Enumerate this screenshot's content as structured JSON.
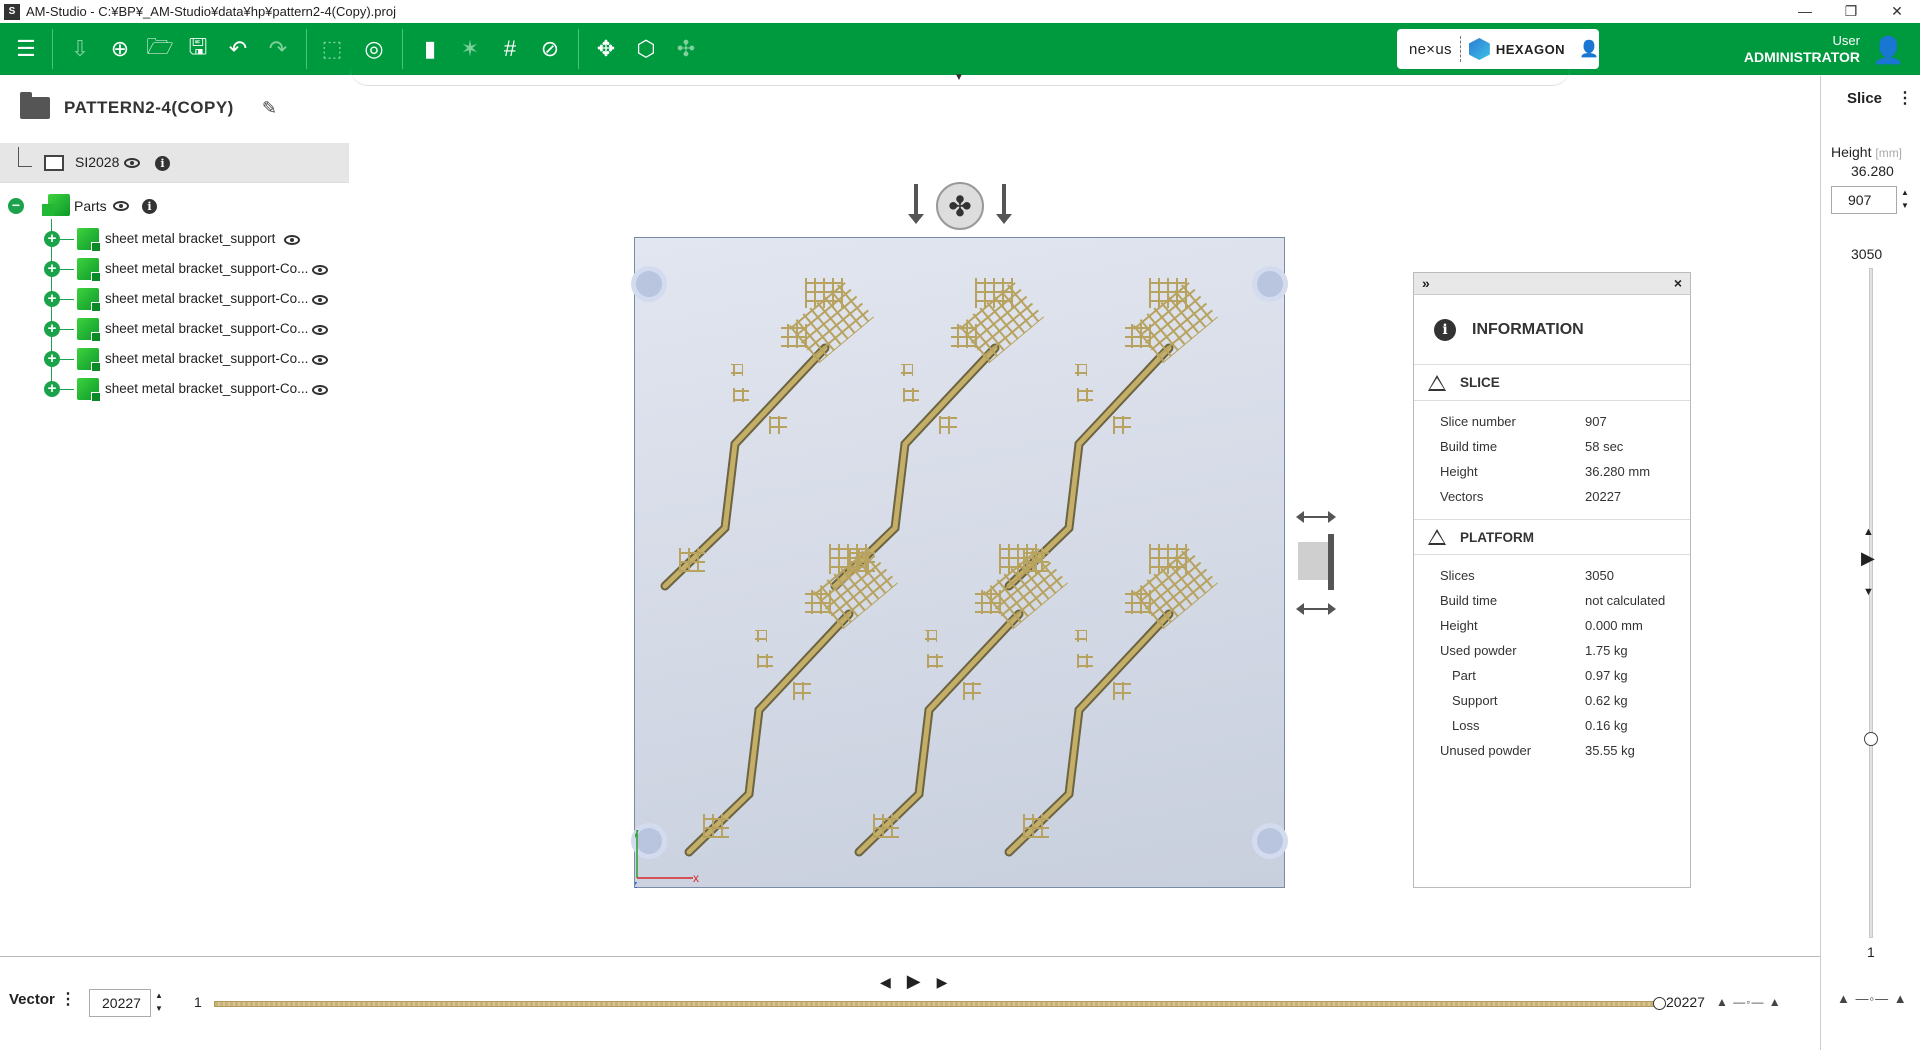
{
  "window": {
    "title": "AM-Studio - C:¥BP¥_AM-Studio¥data¥hp¥pattern2-4(Copy).proj",
    "app_icon_text": "S",
    "controls": {
      "minimize": "—",
      "maximize": "❐",
      "close": "✕"
    }
  },
  "toolbar": {
    "accent_color": "#009a3e",
    "icons": [
      "menu-icon",
      "import-icon",
      "add-icon",
      "open-folder-icon",
      "save-icon",
      "undo-icon",
      "redo-icon",
      "box-view-icon",
      "snapshot-icon",
      "cube-icon",
      "support-icon",
      "hatch-icon",
      "slice-icon",
      "move-icon",
      "orient-icon",
      "disabled-tool-icon"
    ],
    "brand": {
      "nexus": "ne×us",
      "hexagon": "HEXAGON"
    },
    "user": {
      "label": "User",
      "name": "ADMINISTRATOR"
    }
  },
  "project": {
    "title": "PATTERN2-4(COPY)"
  },
  "tree": {
    "machine": "SI2028",
    "parts_label": "Parts",
    "parts": [
      {
        "label": "sheet metal bracket_support"
      },
      {
        "label": "sheet metal bracket_support-Co..."
      },
      {
        "label": "sheet metal bracket_support-Co..."
      },
      {
        "label": "sheet metal bracket_support-Co..."
      },
      {
        "label": "sheet metal bracket_support-Co..."
      },
      {
        "label": "sheet metal bracket_support-Co..."
      }
    ]
  },
  "axes": {
    "x": "x",
    "y": "y",
    "z": "z"
  },
  "info_panel": {
    "title": "INFORMATION",
    "expand": "»",
    "close": "×",
    "slice": {
      "title": "SLICE",
      "rows": [
        {
          "k": "Slice number",
          "v": "907"
        },
        {
          "k": "Build time",
          "v": "58 sec"
        },
        {
          "k": "Height",
          "v": "36.280 mm"
        },
        {
          "k": "Vectors",
          "v": "20227"
        }
      ]
    },
    "platform": {
      "title": "PLATFORM",
      "rows": [
        {
          "k": "Slices",
          "v": "3050"
        },
        {
          "k": "Build time",
          "v": "not calculated"
        },
        {
          "k": "Height",
          "v": "0.000 mm"
        },
        {
          "k": "Used powder",
          "v": "1.75 kg"
        },
        {
          "k": "Part",
          "v": "0.97 kg",
          "indent": true
        },
        {
          "k": "Support",
          "v": "0.62 kg",
          "indent": true
        },
        {
          "k": "Loss",
          "v": "0.16 kg",
          "indent": true
        },
        {
          "k": "Unused powder",
          "v": "35.55 kg"
        }
      ]
    }
  },
  "slice_panel": {
    "title": "Slice",
    "height_label": "Height",
    "height_unit": "[mm]",
    "height_value": "36.280",
    "slice_value": "907",
    "max": "3050",
    "min": "1",
    "current_fraction": 0.297
  },
  "vector_bar": {
    "label": "Vector",
    "value": "20227",
    "min": "1",
    "max": "20227",
    "current_fraction": 1.0
  }
}
